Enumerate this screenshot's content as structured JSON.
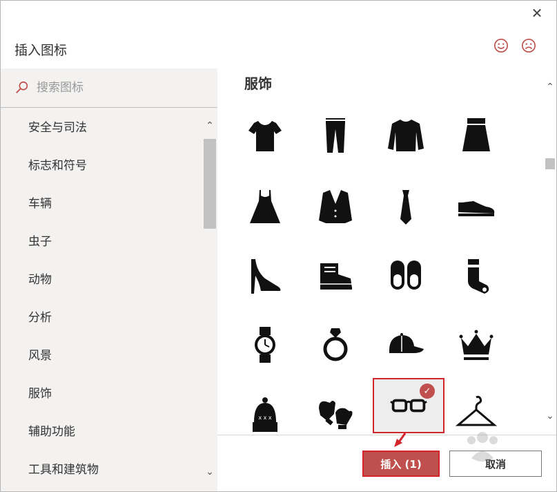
{
  "dialog": {
    "title": "插入图标",
    "close_icon": "close-icon",
    "feedback": [
      "smile-icon",
      "frown-icon"
    ]
  },
  "sidebar": {
    "search_placeholder": "搜索图标",
    "categories": [
      "安全与司法",
      "标志和符号",
      "车辆",
      "虫子",
      "动物",
      "分析",
      "风景",
      "服饰",
      "辅助功能",
      "工具和建筑物"
    ]
  },
  "main": {
    "section_title": "服饰",
    "icons": [
      "t-shirt-icon",
      "pants-icon",
      "sweater-icon",
      "skirt-icon",
      "dress-icon",
      "suit-jacket-icon",
      "tie-icon",
      "dress-shoe-icon",
      "high-heel-icon",
      "boot-icon",
      "slippers-icon",
      "sock-icon",
      "watch-icon",
      "ring-icon",
      "cap-icon",
      "crown-icon",
      "beanie-icon",
      "mittens-icon",
      "glasses-icon",
      "hanger-icon"
    ],
    "selected_icon": "glasses-icon"
  },
  "footer": {
    "insert_label": "插入 (1)",
    "cancel_label": "取消"
  },
  "colors": {
    "accent": "#c0504d",
    "highlight_border": "#d2242a",
    "sidebar_bg": "#f3f2f1"
  }
}
